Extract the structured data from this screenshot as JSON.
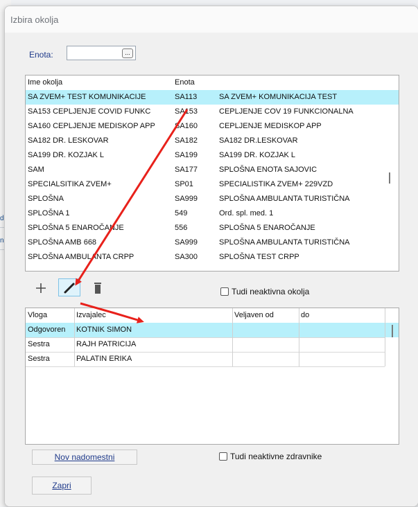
{
  "background": {
    "fragments": [
      "dc",
      "na"
    ]
  },
  "window": {
    "title": "Izbira okolja"
  },
  "enota": {
    "label": "Enota:",
    "value": "",
    "browse_label": "..."
  },
  "environments": {
    "columns": [
      "Ime okolja",
      "Enota",
      ""
    ],
    "rows": [
      [
        "SA ZVEM+ TEST KOMUNIKACIJE",
        "SA113",
        "SA ZVEM+ KOMUNIKACIJA TEST"
      ],
      [
        "SA153 CEPLJENJE COVID FUNKC",
        "SA153",
        "CEPLJENJE COV 19 FUNKCIONALNA"
      ],
      [
        "SA160 CEPLJENJE MEDISKOP APP",
        "SA160",
        "CEPLJENJE MEDISKOP APP"
      ],
      [
        "SA182 DR. LESKOVAR",
        "SA182",
        "SA182 DR.LESKOVAR"
      ],
      [
        "SA199 DR. KOZJAK L",
        "SA199",
        "SA199 DR. KOZJAK L"
      ],
      [
        "SAM",
        "SA177",
        "SPLOŠNA ENOTA SAJOVIC"
      ],
      [
        "SPECIALSITIKA ZVEM+",
        "SP01",
        "SPECIALISTIKA ZVEM+ 229VZD"
      ],
      [
        "SPLOŠNA",
        "SA999",
        "SPLOŠNA AMBULANTA TURISTIČNA"
      ],
      [
        "SPLOŠNA 1",
        "549",
        "Ord. spl. med. 1"
      ],
      [
        "SPLOŠNA 5 ENAROČANJE",
        "556",
        "SPLOŠNA 5 ENAROČANJE"
      ],
      [
        "SPLOŠNA AMB 668",
        "SA999",
        "SPLOŠNA AMBULANTA TURISTIČNA"
      ],
      [
        "SPLOŠNA AMBULANTA CRPP",
        "SA300",
        "SPLOŠNA TEST CRPP"
      ]
    ],
    "selected_index": 0
  },
  "toolbar": {
    "add_icon": "plus-icon",
    "edit_icon": "pencil-icon",
    "delete_icon": "trash-icon"
  },
  "inactive_envs": {
    "label": "Tudi neaktivna okolja",
    "checked": false
  },
  "roles": {
    "columns": [
      "Vloga",
      "Izvajalec",
      "Veljaven od",
      "do"
    ],
    "rows": [
      [
        "Odgovoren",
        "KOTNIK SIMON",
        "",
        ""
      ],
      [
        "Sestra",
        "RAJH PATRICIJA",
        "",
        ""
      ],
      [
        "Sestra",
        "PALATIN ERIKA",
        "",
        ""
      ]
    ],
    "selected_index": 0
  },
  "new_substitute_button": "Nov nadomestni",
  "inactive_doctors": {
    "label": "Tudi neaktivne zdravnike",
    "checked": false
  },
  "close_button": "Zapri",
  "colors": {
    "selection": "#b7f0fb",
    "arrow": "#e8211b",
    "label_blue": "#1f3a8a"
  }
}
